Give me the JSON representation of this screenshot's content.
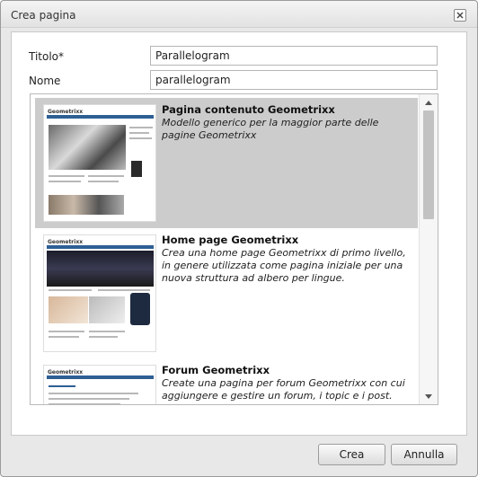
{
  "dialog": {
    "title": "Crea pagina",
    "close_icon": "close-icon"
  },
  "form": {
    "title_label": "Titolo",
    "title_required_mark": "*",
    "title_value": "Parallelogram",
    "name_label": "Nome",
    "name_value": "parallelogram"
  },
  "templates": [
    {
      "name": "Pagina contenuto Geometrixx",
      "description": "Modello generico per la maggior parte delle pagine Geometrixx",
      "selected": true,
      "thumb_logo": "Geometrixx"
    },
    {
      "name": "Home page Geometrixx",
      "description": "Crea una home page Geometrixx di primo livello, in genere utilizzata come pagina iniziale per una nuova struttura ad albero per lingue.",
      "selected": false,
      "thumb_logo": "Geometrixx"
    },
    {
      "name": "Forum Geometrixx",
      "description": "Create una pagina per forum Geometrixx con cui aggiungere e gestire un forum, i topic e i post.",
      "selected": false,
      "thumb_logo": "Geometrixx"
    }
  ],
  "buttons": {
    "create": "Crea",
    "cancel": "Annulla"
  },
  "colors": {
    "selected_row": "#cccccc",
    "nav_blue": "#2d5f94"
  }
}
